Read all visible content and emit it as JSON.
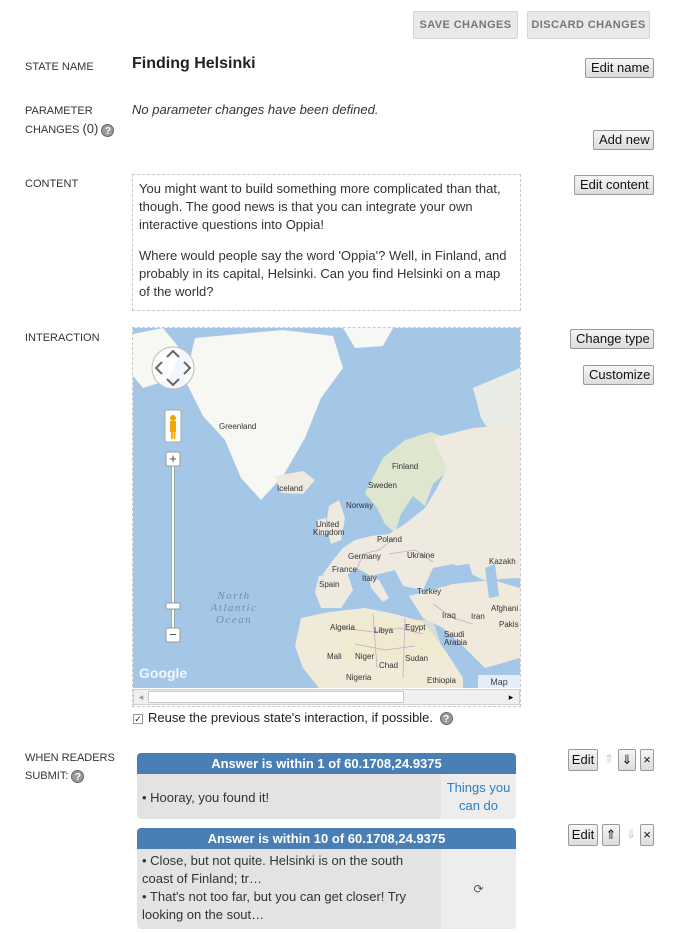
{
  "header": {
    "save_label": "SAVE CHANGES",
    "discard_label": "DISCARD CHANGES"
  },
  "state_name": {
    "label": "STATE NAME",
    "value": "Finding Helsinki",
    "edit_label": "Edit name"
  },
  "params": {
    "label_line1": "PARAMETER",
    "label_line2": "CHANGES",
    "count": "(0)",
    "empty_text": "No parameter changes have been defined.",
    "add_label": "Add new",
    "help": "?"
  },
  "content": {
    "label": "CONTENT",
    "paragraph1": "You might want to build something more complicated than that, though. The good news is that you can integrate your own interactive questions into Oppia!",
    "paragraph2": "Where would people say the word 'Oppia'? Well, in Finland, and probably in its capital, Helsinki. Can you find Helsinki on a map of the world?",
    "edit_label": "Edit content"
  },
  "interaction": {
    "label": "INTERACTION",
    "change_type_label": "Change type",
    "customize_label": "Customize",
    "reuse_checked": true,
    "reuse_text": "Reuse the previous state's interaction, if possible.",
    "map": {
      "ocean_label_1": "North",
      "ocean_label_2": "Atlantic",
      "ocean_label_3": "Ocean",
      "google_logo": "Google",
      "map_type": "Map",
      "zoom_in": "+",
      "zoom_out": "−",
      "places": {
        "greenland": "Greenland",
        "iceland": "Iceland",
        "finland": "Finland",
        "sweden": "Sweden",
        "norway": "Norway",
        "uk_1": "United",
        "uk_2": "Kingdom",
        "poland": "Poland",
        "germany": "Germany",
        "ukraine": "Ukraine",
        "kazakh": "Kazakh",
        "france": "France",
        "italy": "Italy",
        "spain": "Spain",
        "turkey": "Turkey",
        "iraq": "Iraq",
        "iran": "Iran",
        "afghani": "Afghani",
        "pakis": "Pakis",
        "algeria": "Algeria",
        "libya": "Libya",
        "egypt": "Egypt",
        "saudi_1": "Saudi",
        "saudi_2": "Arabia",
        "mali": "Mali",
        "niger": "Niger",
        "chad": "Chad",
        "sudan": "Sudan",
        "nigeria": "Nigeria",
        "ethiopia": "Ethiopia"
      }
    }
  },
  "rules": {
    "label_line1": "WHEN READERS",
    "label_line2": "SUBMIT:",
    "items": [
      {
        "header": "Answer is within 1 of 60.1708,24.9375",
        "feedback": "• Hooray, you found it!",
        "dest": "Things you can do",
        "edit_label": "Edit",
        "up": "⇑",
        "down": "⇓",
        "delete": "×"
      },
      {
        "header": "Answer is within 10 of 60.1708,24.9375",
        "feedback1": "• Close, but not quite. Helsinki is on the south coast of Finland; tr…",
        "feedback2": "• That's not too far, but you can get closer! Try looking on the sout…",
        "dest": "⟳",
        "edit_label": "Edit",
        "up": "⇑",
        "down": "⇓",
        "delete": "×"
      }
    ]
  },
  "colors": {
    "accent": "#4a7fb6",
    "ocean": "#a4c6e7",
    "land": "#eeeae0",
    "greenland": "#f7f7f4"
  }
}
